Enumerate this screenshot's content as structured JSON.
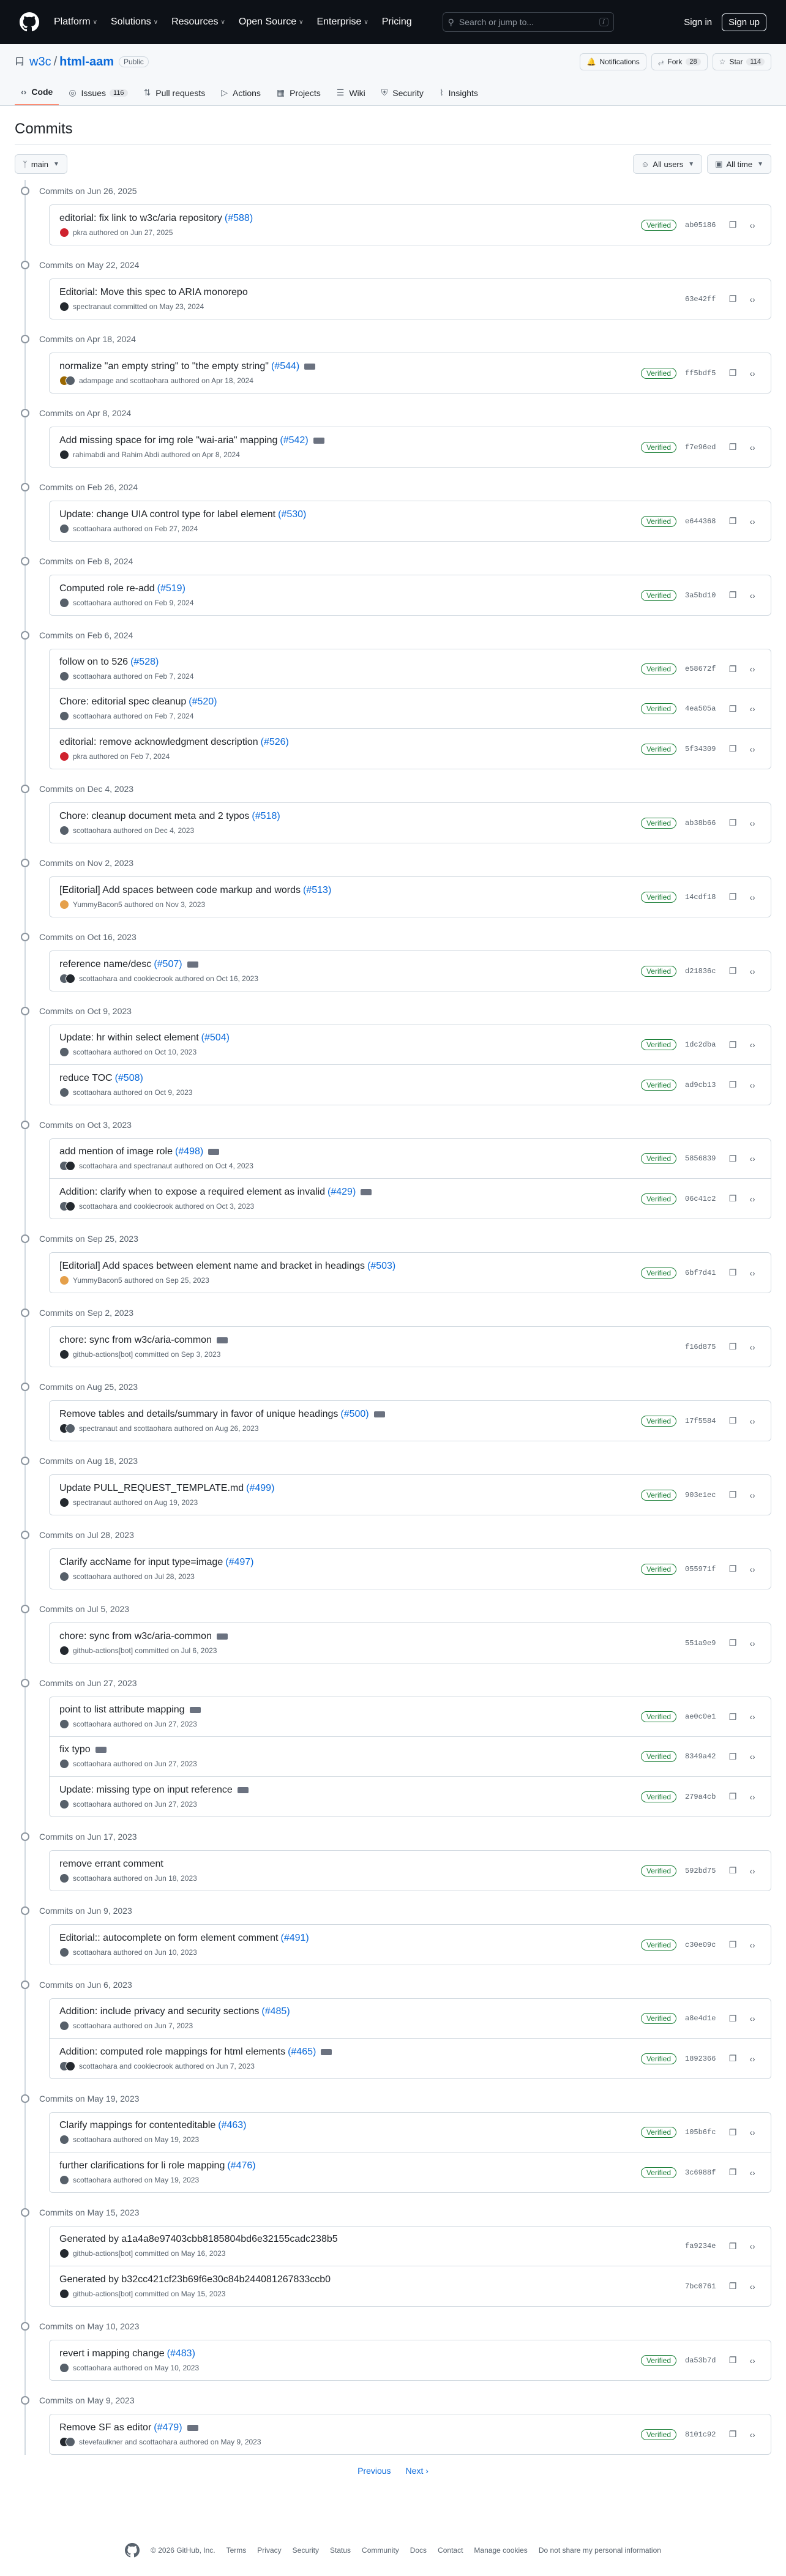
{
  "nav": {
    "items": [
      "Platform",
      "Solutions",
      "Resources",
      "Open Source",
      "Enterprise",
      "Pricing"
    ],
    "search_placeholder": "Search or jump to...",
    "search_key": "/",
    "sign_in": "Sign in",
    "sign_up": "Sign up"
  },
  "repo": {
    "owner": "w3c",
    "name": "html-aam",
    "visibility": "Public",
    "notifications": "Notifications",
    "fork_label": "Fork",
    "fork_count": "28",
    "star_label": "Star",
    "star_count": "114"
  },
  "tabs": [
    {
      "label": "Code",
      "icon": "code-icon",
      "count": ""
    },
    {
      "label": "Issues",
      "icon": "issues-icon",
      "count": "116"
    },
    {
      "label": "Pull requests",
      "icon": "pull-request-icon",
      "count": ""
    },
    {
      "label": "Actions",
      "icon": "actions-icon",
      "count": ""
    },
    {
      "label": "Projects",
      "icon": "projects-icon",
      "count": ""
    },
    {
      "label": "Wiki",
      "icon": "wiki-icon",
      "count": ""
    },
    {
      "label": "Security",
      "icon": "shield-icon",
      "count": ""
    },
    {
      "label": "Insights",
      "icon": "graph-icon",
      "count": ""
    }
  ],
  "page": {
    "title": "Commits",
    "branch": "main",
    "users_filter": "All users",
    "time_filter": "All time"
  },
  "groups": [
    {
      "date": "Commits on Jun 26, 2025",
      "commits": [
        {
          "message": "editorial: fix link to w3c/aria repository",
          "pr": "(#588)",
          "ellipsis": false,
          "meta": "pkra authored on Jun 27, 2025",
          "avatars": [
            "#cf222e"
          ],
          "verified": "Verified",
          "sha": "ab05186"
        }
      ]
    },
    {
      "date": "Commits on May 22, 2024",
      "commits": [
        {
          "message": "Editorial: Move this spec to ARIA monorepo",
          "pr": "",
          "ellipsis": false,
          "meta": "spectranaut committed on May 23, 2024",
          "avatars": [
            "#24292f"
          ],
          "verified": "",
          "sha": "63e42ff"
        }
      ]
    },
    {
      "date": "Commits on Apr 18, 2024",
      "commits": [
        {
          "message": "normalize \"an empty string\" to \"the empty string\"",
          "pr": "(#544)",
          "ellipsis": true,
          "meta": "adampage and scottaohara authored on Apr 18, 2024",
          "avatars": [
            "#9a6700",
            "#57606a"
          ],
          "verified": "Verified",
          "sha": "ff5bdf5"
        }
      ]
    },
    {
      "date": "Commits on Apr 8, 2024",
      "commits": [
        {
          "message": "Add missing space for img role \"wai-aria\" mapping",
          "pr": "(#542)",
          "ellipsis": true,
          "meta": "rahimabdi and Rahim Abdi authored on Apr 8, 2024",
          "avatars": [
            "#24292f"
          ],
          "verified": "Verified",
          "sha": "f7e96ed"
        }
      ]
    },
    {
      "date": "Commits on Feb 26, 2024",
      "commits": [
        {
          "message": "Update: change UIA control type for label element",
          "pr": "(#530)",
          "ellipsis": false,
          "meta": "scottaohara authored on Feb 27, 2024",
          "avatars": [
            "#57606a"
          ],
          "verified": "Verified",
          "sha": "e644368"
        }
      ]
    },
    {
      "date": "Commits on Feb 8, 2024",
      "commits": [
        {
          "message": "Computed role re-add",
          "pr": "(#519)",
          "ellipsis": false,
          "meta": "scottaohara authored on Feb 9, 2024",
          "avatars": [
            "#57606a"
          ],
          "verified": "Verified",
          "sha": "3a5bd10"
        }
      ]
    },
    {
      "date": "Commits on Feb 6, 2024",
      "commits": [
        {
          "message": "follow on to 526",
          "pr": "(#528)",
          "ellipsis": false,
          "meta": "scottaohara authored on Feb 7, 2024",
          "avatars": [
            "#57606a"
          ],
          "verified": "Verified",
          "sha": "e58672f"
        },
        {
          "message": "Chore: editorial spec cleanup",
          "pr": "(#520)",
          "ellipsis": false,
          "meta": "scottaohara authored on Feb 7, 2024",
          "avatars": [
            "#57606a"
          ],
          "verified": "Verified",
          "sha": "4ea505a"
        },
        {
          "message": "editorial: remove acknowledgment description",
          "pr": "(#526)",
          "ellipsis": false,
          "meta": "pkra authored on Feb 7, 2024",
          "avatars": [
            "#cf222e"
          ],
          "verified": "Verified",
          "sha": "5f34309"
        }
      ]
    },
    {
      "date": "Commits on Dec 4, 2023",
      "commits": [
        {
          "message": "Chore: cleanup document meta and 2 typos",
          "pr": "(#518)",
          "ellipsis": false,
          "meta": "scottaohara authored on Dec 4, 2023",
          "avatars": [
            "#57606a"
          ],
          "verified": "Verified",
          "sha": "ab38b66"
        }
      ]
    },
    {
      "date": "Commits on Nov 2, 2023",
      "commits": [
        {
          "message": "[Editorial] Add spaces between code markup and words",
          "pr": "(#513)",
          "ellipsis": false,
          "meta": "YummyBacon5 authored on Nov 3, 2023",
          "avatars": [
            "#e5a04b"
          ],
          "verified": "Verified",
          "sha": "14cdf18"
        }
      ]
    },
    {
      "date": "Commits on Oct 16, 2023",
      "commits": [
        {
          "message": "reference name/desc",
          "pr": "(#507)",
          "ellipsis": true,
          "meta": "scottaohara and cookiecrook authored on Oct 16, 2023",
          "avatars": [
            "#57606a",
            "#24292f"
          ],
          "verified": "Verified",
          "sha": "d21836c"
        }
      ]
    },
    {
      "date": "Commits on Oct 9, 2023",
      "commits": [
        {
          "message": "Update: hr within select element",
          "pr": "(#504)",
          "ellipsis": false,
          "meta": "scottaohara authored on Oct 10, 2023",
          "avatars": [
            "#57606a"
          ],
          "verified": "Verified",
          "sha": "1dc2dba"
        },
        {
          "message": "reduce TOC",
          "pr": "(#508)",
          "ellipsis": false,
          "meta": "scottaohara authored on Oct 9, 2023",
          "avatars": [
            "#57606a"
          ],
          "verified": "Verified",
          "sha": "ad9cb13"
        }
      ]
    },
    {
      "date": "Commits on Oct 3, 2023",
      "commits": [
        {
          "message": "add mention of image role",
          "pr": "(#498)",
          "ellipsis": true,
          "meta": "scottaohara and spectranaut authored on Oct 4, 2023",
          "avatars": [
            "#57606a",
            "#24292f"
          ],
          "verified": "Verified",
          "sha": "5856839"
        },
        {
          "message": "Addition: clarify when to expose a required element as invalid",
          "pr": "(#429)",
          "ellipsis": true,
          "meta": "scottaohara and cookiecrook authored on Oct 3, 2023",
          "avatars": [
            "#57606a",
            "#24292f"
          ],
          "verified": "Verified",
          "sha": "06c41c2"
        }
      ]
    },
    {
      "date": "Commits on Sep 25, 2023",
      "commits": [
        {
          "message": "[Editorial] Add spaces between element name and bracket in headings",
          "pr": "(#503)",
          "ellipsis": false,
          "meta": "YummyBacon5 authored on Sep 25, 2023",
          "avatars": [
            "#e5a04b"
          ],
          "verified": "Verified",
          "sha": "6bf7d41"
        }
      ]
    },
    {
      "date": "Commits on Sep 2, 2023",
      "commits": [
        {
          "message": "chore: sync from w3c/aria-common",
          "pr": "",
          "ellipsis": true,
          "meta": "github-actions[bot] committed on Sep 3, 2023",
          "avatars": [
            "#24292f"
          ],
          "verified": "",
          "sha": "f16d875"
        }
      ]
    },
    {
      "date": "Commits on Aug 25, 2023",
      "commits": [
        {
          "message": "Remove tables and details/summary in favor of unique headings",
          "pr": "(#500)",
          "ellipsis": true,
          "meta": "spectranaut and scottaohara authored on Aug 26, 2023",
          "avatars": [
            "#24292f",
            "#57606a"
          ],
          "verified": "Verified",
          "sha": "17f5584"
        }
      ]
    },
    {
      "date": "Commits on Aug 18, 2023",
      "commits": [
        {
          "message": "Update PULL_REQUEST_TEMPLATE.md",
          "pr": "(#499)",
          "ellipsis": false,
          "meta": "spectranaut authored on Aug 19, 2023",
          "avatars": [
            "#24292f"
          ],
          "verified": "Verified",
          "sha": "903e1ec"
        }
      ]
    },
    {
      "date": "Commits on Jul 28, 2023",
      "commits": [
        {
          "message": "Clarify accName for input type=image",
          "pr": "(#497)",
          "ellipsis": false,
          "meta": "scottaohara authored on Jul 28, 2023",
          "avatars": [
            "#57606a"
          ],
          "verified": "Verified",
          "sha": "055971f"
        }
      ]
    },
    {
      "date": "Commits on Jul 5, 2023",
      "commits": [
        {
          "message": "chore: sync from w3c/aria-common",
          "pr": "",
          "ellipsis": true,
          "meta": "github-actions[bot] committed on Jul 6, 2023",
          "avatars": [
            "#24292f"
          ],
          "verified": "",
          "sha": "551a9e9"
        }
      ]
    },
    {
      "date": "Commits on Jun 27, 2023",
      "commits": [
        {
          "message": "point to list attribute mapping",
          "pr": "",
          "ellipsis": true,
          "meta": "scottaohara authored on Jun 27, 2023",
          "avatars": [
            "#57606a"
          ],
          "verified": "Verified",
          "sha": "ae0c0e1"
        },
        {
          "message": "fix typo",
          "pr": "",
          "ellipsis": true,
          "meta": "scottaohara authored on Jun 27, 2023",
          "avatars": [
            "#57606a"
          ],
          "verified": "Verified",
          "sha": "8349a42"
        },
        {
          "message": "Update: missing type on input reference",
          "pr": "",
          "ellipsis": true,
          "meta": "scottaohara authored on Jun 27, 2023",
          "avatars": [
            "#57606a"
          ],
          "verified": "Verified",
          "sha": "279a4cb"
        }
      ]
    },
    {
      "date": "Commits on Jun 17, 2023",
      "commits": [
        {
          "message": "remove errant comment",
          "pr": "",
          "ellipsis": false,
          "meta": "scottaohara authored on Jun 18, 2023",
          "avatars": [
            "#57606a"
          ],
          "verified": "Verified",
          "sha": "592bd75"
        }
      ]
    },
    {
      "date": "Commits on Jun 9, 2023",
      "commits": [
        {
          "message": "Editorial:: autocomplete on form element comment",
          "pr": "(#491)",
          "ellipsis": false,
          "meta": "scottaohara authored on Jun 10, 2023",
          "avatars": [
            "#57606a"
          ],
          "verified": "Verified",
          "sha": "c30e09c"
        }
      ]
    },
    {
      "date": "Commits on Jun 6, 2023",
      "commits": [
        {
          "message": "Addition: include privacy and security sections",
          "pr": "(#485)",
          "ellipsis": false,
          "meta": "scottaohara authored on Jun 7, 2023",
          "avatars": [
            "#57606a"
          ],
          "verified": "Verified",
          "sha": "a8e4d1e"
        },
        {
          "message": "Addition: computed role mappings for html elements",
          "pr": "(#465)",
          "ellipsis": true,
          "meta": "scottaohara and cookiecrook authored on Jun 7, 2023",
          "avatars": [
            "#57606a",
            "#24292f"
          ],
          "verified": "Verified",
          "sha": "1892366"
        }
      ]
    },
    {
      "date": "Commits on May 19, 2023",
      "commits": [
        {
          "message": "Clarify mappings for contenteditable",
          "pr": "(#463)",
          "ellipsis": false,
          "meta": "scottaohara authored on May 19, 2023",
          "avatars": [
            "#57606a"
          ],
          "verified": "Verified",
          "sha": "105b6fc"
        },
        {
          "message": "further clarifications for li role mapping",
          "pr": "(#476)",
          "ellipsis": false,
          "meta": "scottaohara authored on May 19, 2023",
          "avatars": [
            "#57606a"
          ],
          "verified": "Verified",
          "sha": "3c6988f"
        }
      ]
    },
    {
      "date": "Commits on May 15, 2023",
      "commits": [
        {
          "message": "Generated by a1a4a8e97403cbb8185804bd6e32155cadc238b5",
          "pr": "",
          "ellipsis": false,
          "meta": "github-actions[bot] committed on May 16, 2023",
          "avatars": [
            "#24292f"
          ],
          "verified": "",
          "sha": "fa9234e"
        },
        {
          "message": "Generated by b32cc421cf23b69f6e30c84b244081267833ccb0",
          "pr": "",
          "ellipsis": false,
          "meta": "github-actions[bot] committed on May 15, 2023",
          "avatars": [
            "#24292f"
          ],
          "verified": "",
          "sha": "7bc0761"
        }
      ]
    },
    {
      "date": "Commits on May 10, 2023",
      "commits": [
        {
          "message": "revert i mapping change",
          "pr": "(#483)",
          "ellipsis": false,
          "meta": "scottaohara authored on May 10, 2023",
          "avatars": [
            "#57606a"
          ],
          "verified": "Verified",
          "sha": "da53b7d"
        }
      ]
    },
    {
      "date": "Commits on May 9, 2023",
      "commits": [
        {
          "message": "Remove SF as editor",
          "pr": "(#479)",
          "ellipsis": true,
          "meta": "stevefaulkner and scottaohara authored on May 9, 2023",
          "avatars": [
            "#24292f",
            "#57606a"
          ],
          "verified": "Verified",
          "sha": "8101c92"
        }
      ]
    }
  ],
  "pagination": {
    "previous": "Previous",
    "next": "Next"
  },
  "footer": {
    "copyright": "© 2026 GitHub, Inc.",
    "links": [
      "Terms",
      "Privacy",
      "Security",
      "Status",
      "Community",
      "Docs",
      "Contact",
      "Manage cookies",
      "Do not share my personal information"
    ]
  },
  "colors": {
    "accent": "#0969da",
    "verified": "#1a7f37",
    "topnav": "#0d1117",
    "tab_underline": "#fd8c73"
  }
}
